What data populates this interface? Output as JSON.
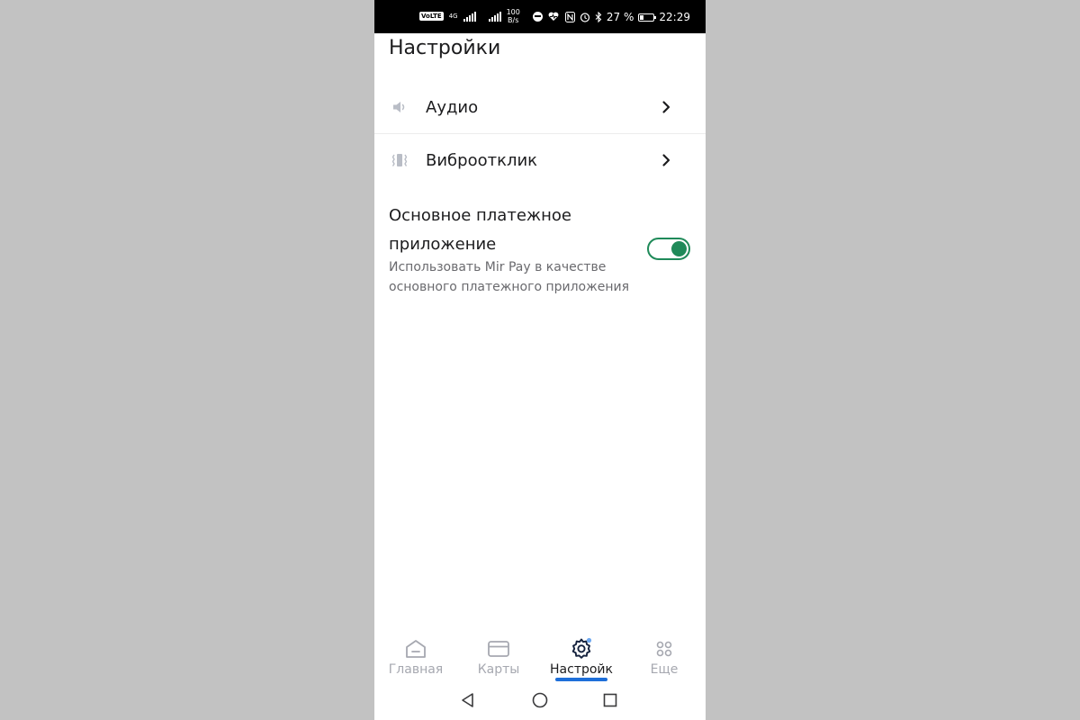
{
  "status_bar": {
    "volte": "VoLTE",
    "network_type": "4G",
    "speed_value": "100",
    "speed_unit": "B/s",
    "battery_percent": "27 %",
    "time": "22:29",
    "icons": [
      "signal-icon",
      "dnd-icon",
      "health-icon",
      "nfc-icon",
      "alarm-icon",
      "bluetooth-icon",
      "battery-icon"
    ]
  },
  "header": {
    "title": "Настройки"
  },
  "settings": {
    "items": [
      {
        "label": "Аудио",
        "icon": "speaker-icon"
      },
      {
        "label": "Виброотклик",
        "icon": "vibration-icon"
      }
    ],
    "payment": {
      "title": "Основное платежное приложение",
      "subtitle": "Использовать Mir Pay в качестве основного платежного приложения",
      "enabled": true
    }
  },
  "bottom_nav": {
    "tabs": [
      {
        "label": "Главная",
        "icon": "home-icon",
        "active": false
      },
      {
        "label": "Карты",
        "icon": "card-icon",
        "active": false
      },
      {
        "label": "Настройк",
        "icon": "settings-gear-icon",
        "active": true
      },
      {
        "label": "Еще",
        "icon": "more-grid-icon",
        "active": false
      }
    ]
  },
  "colors": {
    "accent_green": "#1f8a59",
    "active_indicator": "#1e6fd9",
    "inactive_text": "#a6a8b0",
    "background_outer": "#c2c2c2"
  }
}
